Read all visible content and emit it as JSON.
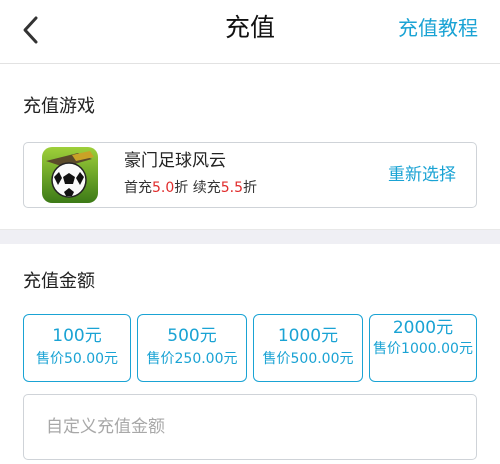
{
  "header": {
    "title": "充值",
    "tutorial_label": "充值教程",
    "back_icon": "chevron-left-icon"
  },
  "game_section": {
    "label": "充值游戏",
    "game": {
      "name": "豪门足球风云",
      "icon": "soccer-ball-game-icon",
      "first_label": "首充",
      "first_discount": "5.0",
      "unit": "折",
      "renew_label": "续充",
      "renew_discount": "5.5",
      "discount_color": "#e02b2b"
    },
    "reselect_label": "重新选择"
  },
  "amount_section": {
    "label": "充值金额",
    "options": [
      {
        "value": "100元",
        "price": "售价50.00元"
      },
      {
        "value": "500元",
        "price": "售价250.00元"
      },
      {
        "value": "1000元",
        "price": "售价500.00元"
      },
      {
        "value": "2000元",
        "price": "售价1000.00元"
      }
    ],
    "custom_placeholder": "自定义充值金额"
  },
  "colors": {
    "accent": "#1aa3d4",
    "background": "#efeff4"
  }
}
